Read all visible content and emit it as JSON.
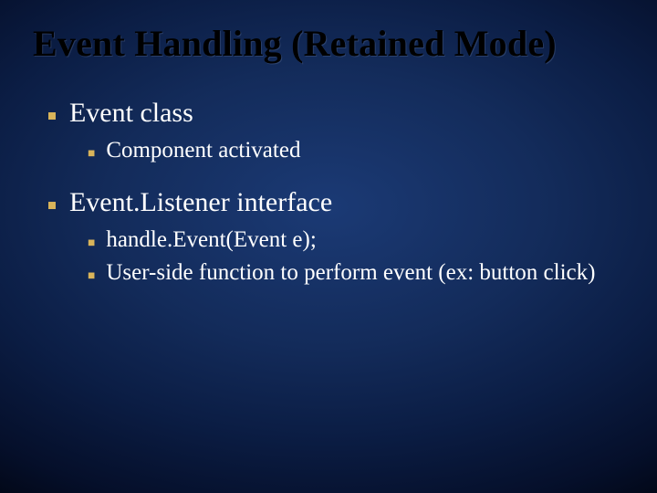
{
  "title": "Event Handling (Retained Mode)",
  "items": [
    {
      "text": "Event class"
    },
    {
      "text": "Component activated"
    },
    {
      "text": "Event.Listener interface"
    },
    {
      "text": "handle.Event(Event e);"
    },
    {
      "text": "User-side function to perform event (ex: button click)"
    }
  ]
}
